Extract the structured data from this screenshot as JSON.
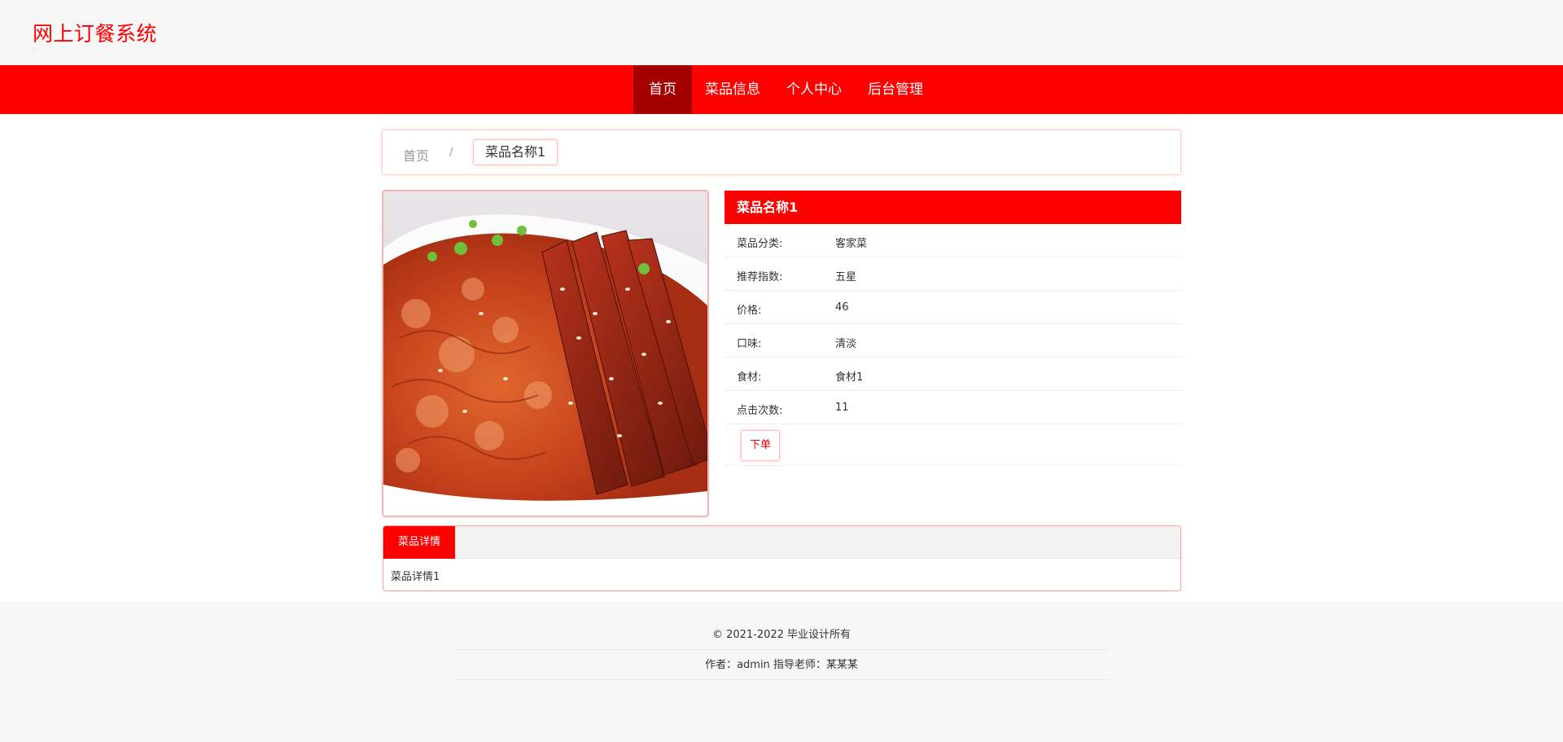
{
  "header": {
    "site_title": "网上订餐系统"
  },
  "nav": {
    "items": [
      {
        "label": "首页",
        "active": true
      },
      {
        "label": "菜品信息",
        "active": false
      },
      {
        "label": "个人中心",
        "active": false
      },
      {
        "label": "后台管理",
        "active": false
      }
    ],
    "accent_color": "#ff0000",
    "active_color": "#a40000"
  },
  "breadcrumb": {
    "home": "首页",
    "separator": "/",
    "current": "菜品名称1"
  },
  "dish": {
    "image_alt": "food-photo",
    "name": "菜品名称1",
    "fields": [
      {
        "label": "菜品分类:",
        "value": "客家菜"
      },
      {
        "label": "推荐指数:",
        "value": "五星"
      },
      {
        "label": "价格:",
        "value": "46"
      },
      {
        "label": "口味:",
        "value": "清淡"
      },
      {
        "label": "食材:",
        "value": "食材1"
      },
      {
        "label": "点击次数:",
        "value": "11"
      }
    ],
    "order_button": "下单"
  },
  "detail": {
    "tab_label": "菜品详情",
    "content": "菜品详情1"
  },
  "footer": {
    "copyright": "© 2021-2022 毕业设计所有",
    "credits": "作者：admin 指导老师：某某某"
  }
}
